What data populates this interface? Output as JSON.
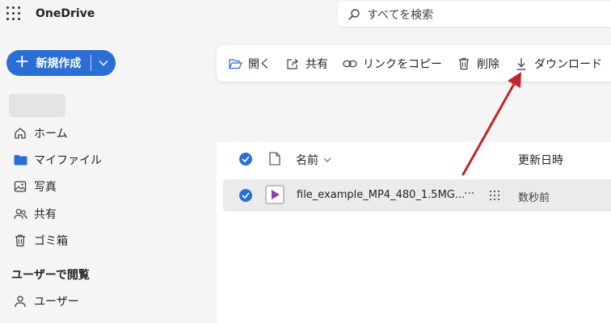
{
  "app": {
    "title": "OneDrive"
  },
  "search": {
    "placeholder": "すべてを検索"
  },
  "new_button": {
    "label": "新規作成"
  },
  "sidebar": {
    "items": [
      {
        "label": "ホーム",
        "icon": "home-icon"
      },
      {
        "label": "マイファイル",
        "icon": "folder-icon"
      },
      {
        "label": "写真",
        "icon": "photo-icon"
      },
      {
        "label": "共有",
        "icon": "people-icon"
      },
      {
        "label": "ゴミ箱",
        "icon": "trash-icon"
      }
    ],
    "section_title": "ユーザーで閲覧",
    "section_items": [
      {
        "label": "ユーザー",
        "icon": "person-icon"
      }
    ]
  },
  "commands": [
    {
      "label": "開く",
      "icon": "open-folder-icon"
    },
    {
      "label": "共有",
      "icon": "share-icon"
    },
    {
      "label": "リンクをコピー",
      "icon": "link-icon"
    },
    {
      "label": "削除",
      "icon": "trash-icon"
    },
    {
      "label": "ダウンロード",
      "icon": "download-icon"
    }
  ],
  "file_list": {
    "columns": {
      "name": "名前",
      "modified": "更新日時"
    },
    "rows": [
      {
        "name": "file_example_MP4_480_1.5MG...",
        "modified": "数秒前",
        "icon": "video-file-icon",
        "more": "···"
      }
    ]
  },
  "colors": {
    "accent": "#2b6fd6",
    "arrow": "#c0262b"
  }
}
